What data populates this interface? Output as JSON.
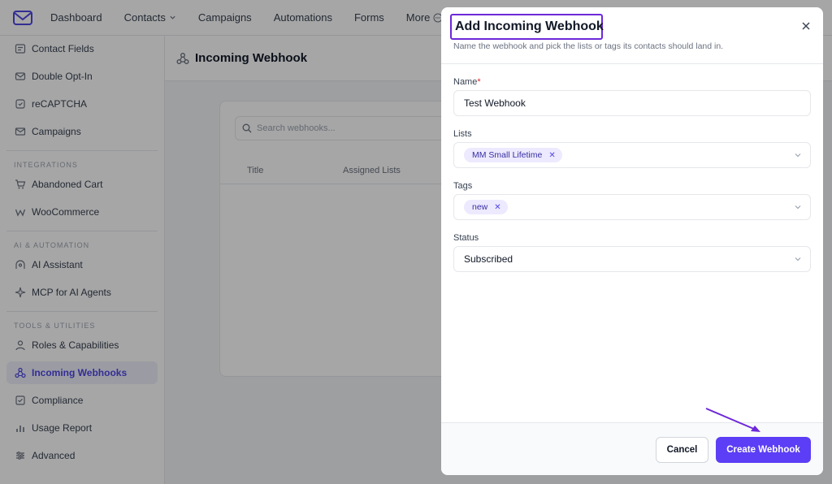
{
  "topnav": {
    "items": [
      {
        "label": "Dashboard"
      },
      {
        "label": "Contacts"
      },
      {
        "label": "Campaigns"
      },
      {
        "label": "Automations"
      },
      {
        "label": "Forms"
      },
      {
        "label": "More"
      }
    ]
  },
  "sidebar": {
    "items_top": [
      {
        "label": "Contact Fields",
        "icon": "fields-icon"
      },
      {
        "label": "Double Opt-In",
        "icon": "optin-icon"
      },
      {
        "label": "reCAPTCHA",
        "icon": "recaptcha-icon"
      },
      {
        "label": "Campaigns",
        "icon": "mail-icon"
      }
    ],
    "section_integrations": "INTEGRATIONS",
    "items_integrations": [
      {
        "label": "Abandoned Cart",
        "icon": "cart-icon"
      },
      {
        "label": "WooCommerce",
        "icon": "woo-icon"
      }
    ],
    "section_ai": "AI & AUTOMATION",
    "items_ai": [
      {
        "label": "AI Assistant",
        "icon": "ai-icon"
      },
      {
        "label": "MCP for AI Agents",
        "icon": "mcp-icon"
      }
    ],
    "section_tools": "TOOLS & UTILITIES",
    "items_tools": [
      {
        "label": "Roles & Capabilities",
        "icon": "roles-icon"
      },
      {
        "label": "Incoming Webhooks",
        "icon": "webhook-icon"
      },
      {
        "label": "Compliance",
        "icon": "compliance-icon"
      },
      {
        "label": "Usage Report",
        "icon": "report-icon"
      },
      {
        "label": "Advanced",
        "icon": "advanced-icon"
      }
    ]
  },
  "main": {
    "title": "Incoming Webhook",
    "search_placeholder": "Search webhooks...",
    "columns": [
      "Title",
      "Assigned Lists"
    ]
  },
  "modal": {
    "title": "Add Incoming Webhook",
    "subtitle": "Name the webhook and pick the lists or tags its contacts should land in.",
    "name_label": "Name",
    "name_required_mark": "*",
    "name_value": "Test Webhook",
    "lists_label": "Lists",
    "lists_selected": "MM Small Lifetime",
    "tags_label": "Tags",
    "tags_selected": "new",
    "status_label": "Status",
    "status_value": "Subscribed",
    "cancel_label": "Cancel",
    "create_label": "Create Webhook"
  },
  "colors": {
    "accent": "#5b3ef5",
    "highlight_box": "#6d28d9",
    "tag_bg": "#ede9fe"
  }
}
